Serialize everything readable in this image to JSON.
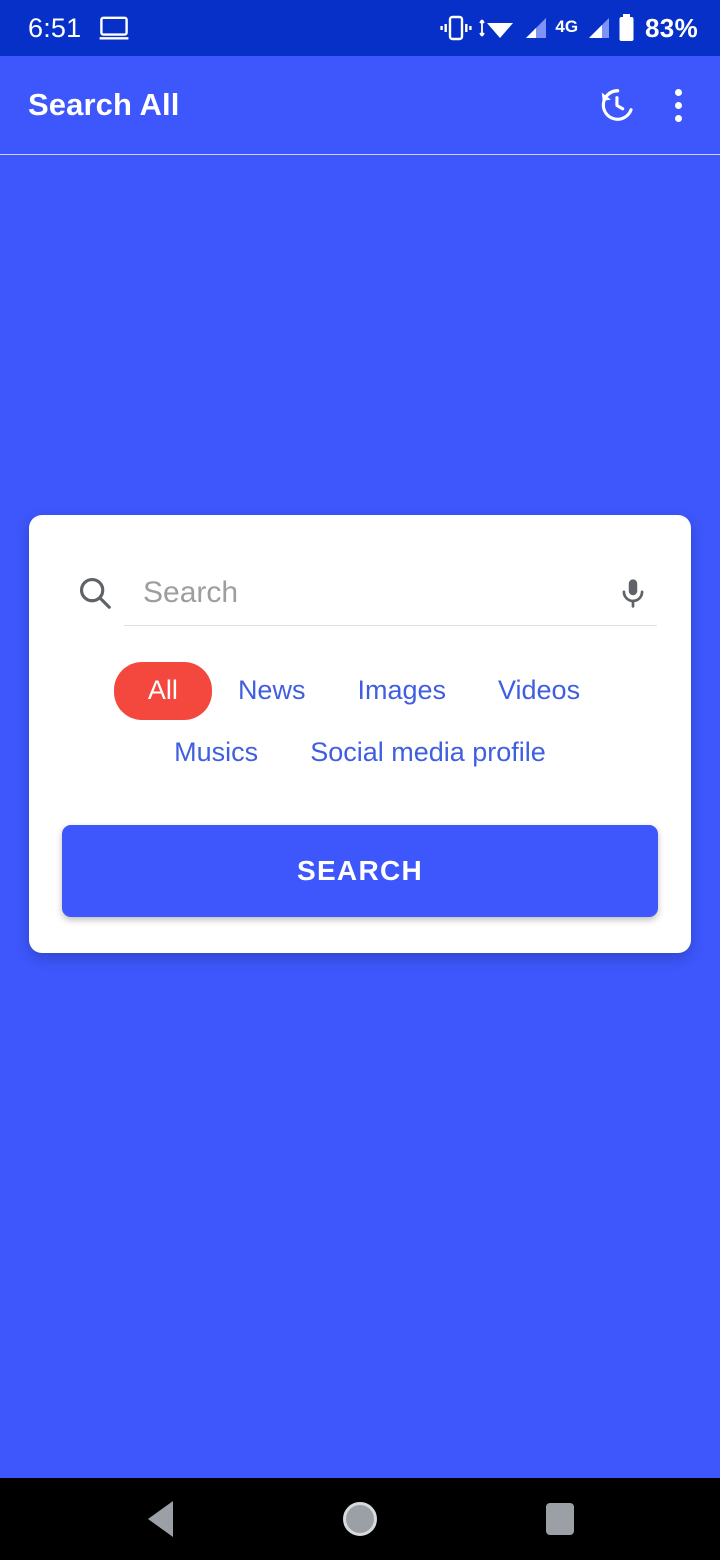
{
  "status_bar": {
    "time": "6:51",
    "battery_percent": "83%",
    "network_label": "4G",
    "icons": [
      "screen-cast-icon",
      "vibrate-icon",
      "wifi-icon",
      "signal-icon",
      "signal-icon-2",
      "battery-icon"
    ],
    "background_color": "#0730c9"
  },
  "app_bar": {
    "title": "Search All",
    "history_action": "history-icon",
    "overflow_action": "overflow-menu-icon",
    "background_color": "#3d57fc"
  },
  "search_card": {
    "search_field": {
      "value": "",
      "placeholder": "Search",
      "leading_icon": "search-icon",
      "trailing_icon": "mic-icon"
    },
    "chips_row_1": [
      {
        "label": "All",
        "selected": true
      },
      {
        "label": "News",
        "selected": false
      },
      {
        "label": "Images",
        "selected": false
      },
      {
        "label": "Videos",
        "selected": false
      }
    ],
    "chips_row_2": [
      {
        "label": "Musics",
        "selected": false
      },
      {
        "label": "Social media profile",
        "selected": false
      }
    ],
    "submit_button_label": "SEARCH",
    "selected_chip_color": "#f4483f",
    "chip_text_color": "#3f5fe0",
    "button_color": "#3d57fc"
  },
  "nav_bar": {
    "back_label": "back-icon",
    "home_label": "home-icon",
    "recents_label": "recents-icon",
    "background_color": "#000000"
  }
}
